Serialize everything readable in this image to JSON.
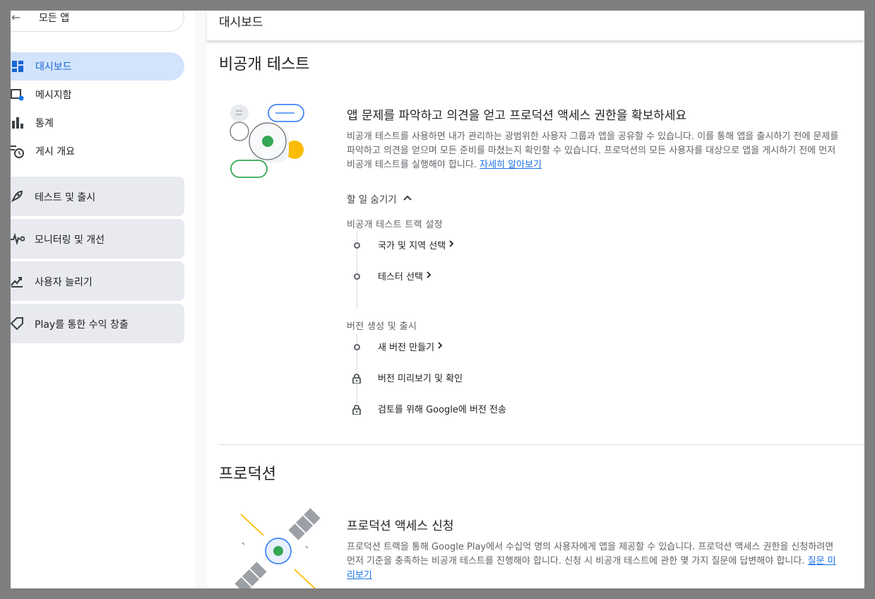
{
  "sidebar": {
    "back_label": "모든 앱",
    "items": [
      {
        "label": "대시보드",
        "icon": "dashboard-icon",
        "active": true
      },
      {
        "label": "메시지함",
        "icon": "inbox-icon",
        "active": false
      },
      {
        "label": "통계",
        "icon": "bar-chart-icon",
        "active": false
      },
      {
        "label": "게시 개요",
        "icon": "schedule-icon",
        "active": false
      }
    ],
    "groups": [
      {
        "label": "테스트 및 출시",
        "icon": "rocket-icon"
      },
      {
        "label": "모니터링 및 개선",
        "icon": "monitoring-icon"
      },
      {
        "label": "사용자 늘리기",
        "icon": "growth-icon"
      },
      {
        "label": "Play를 통한 수익 창출",
        "icon": "tag-icon"
      }
    ]
  },
  "header": {
    "title": "대시보드"
  },
  "closed_testing": {
    "section_title": "비공개 테스트",
    "card_title": "앱 문제를 파악하고 의견을 얻고 프로덕션 액세스 권한을 확보하세요",
    "desc_line1": "비공개 테스트를 사용하면 내가 관리하는 광범위한 사용자 그룹과 앱을 공유할 수 있습니다. 이를 통해 앱을 출시하기 전에 문제를",
    "desc_line2": "파악하고 의견을 얻으며 모든 준비를 마쳤는지 확인할 수 있습니다. 프로덕션의 모든 사용자를 대상으로 앱을 게시하기 전에 먼저",
    "desc_line3": "비공개 테스트를 실행해야 합니다.",
    "learn_more": "자세히 알아보기",
    "toggle_label": "할 일 숨기기",
    "group1_label": "비공개 테스트 트랙 설정",
    "group1_steps": [
      {
        "label": "국가 및 지역 선택",
        "locked": false
      },
      {
        "label": "테스터 선택",
        "locked": false
      }
    ],
    "group2_label": "버전 생성 및 출시",
    "group2_steps": [
      {
        "label": "새 버전 만들기",
        "locked": false
      },
      {
        "label": "버전 미리보기 및 확인",
        "locked": true
      },
      {
        "label": "검토를 위해 Google에 버전 전송",
        "locked": true
      }
    ]
  },
  "production": {
    "section_title": "프로덕션",
    "card_title": "프로덕션 액세스 신청",
    "desc_line1": "프로덕션 트랙을 통해 Google Play에서 수십억 명의 사용자에게 앱을 제공할 수 있습니다. 프로덕션 액세스 권한을 신청하려면",
    "desc_line2": "먼저 기준을 충족하는 비공개 테스트를 진행해야 합니다. 신청 시 비공개 테스트에 관한 몇 가지 질문에 답변해야 합니다.",
    "learn_more_part1": "질문 미",
    "learn_more_part2": "리보기"
  },
  "colors": {
    "active_bg": "#d2e3fc",
    "active_text": "#1967d2",
    "link": "#1a73e8",
    "green": "#34a853",
    "yellow": "#fbbc04",
    "blue": "#4285f4"
  }
}
